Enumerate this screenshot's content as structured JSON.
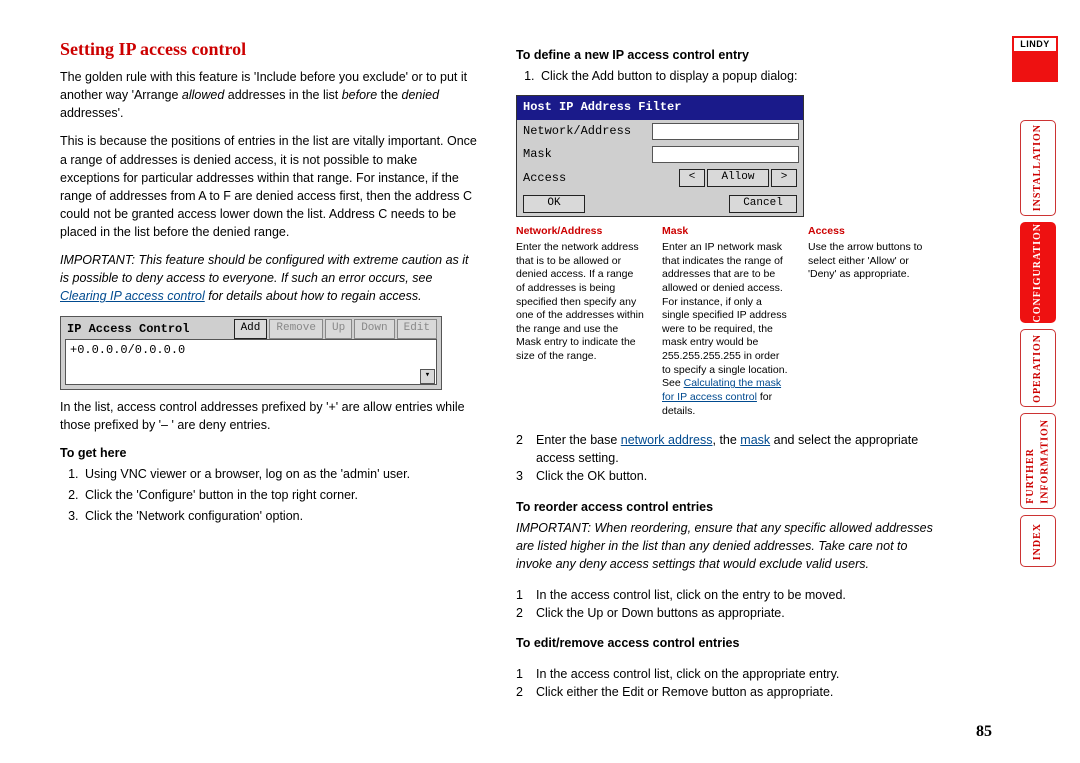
{
  "page_number": "85",
  "logo": "LINDY",
  "nav": {
    "installation": "INSTALLATION",
    "configuration": "CONFIGURATION",
    "operation": "OPERATION",
    "further_info": "FURTHER\nINFORMATION",
    "index": "INDEX"
  },
  "left": {
    "h1": "Setting IP access control",
    "p1a": "The golden rule with this feature is 'Include before you exclude' or to put it another way 'Arrange ",
    "p1b": "allowed",
    "p1c": " addresses in the list ",
    "p1d": "before",
    "p1e": " the ",
    "p1f": "denied",
    "p1g": " addresses'.",
    "p2": "This is because the positions of entries in the list are vitally important. Once a range of addresses is denied access, it is not possible to make exceptions for particular addresses within that range. For instance, if the range of addresses from A to F are denied access first, then the address C could not be granted access lower down the list. Address C needs to be placed in the list before the denied range.",
    "p3a": "IMPORTANT: This feature should be configured with extreme caution as it is possible to deny access to everyone. If such an error occurs, see ",
    "p3link": "Clearing IP access control",
    "p3b": " for details about how to regain access.",
    "panel": {
      "title": "IP Access Control",
      "entry": "+0.0.0.0/0.0.0.0",
      "btn_add": "Add",
      "btn_remove": "Remove",
      "btn_up": "Up",
      "btn_down": "Down",
      "btn_edit": "Edit"
    },
    "p4": "In the list, access control addresses prefixed by '+' are allow entries while those prefixed by '– ' are deny entries.",
    "h_get": "To get here",
    "get1": "Using VNC viewer or a browser, log on as the 'admin' user.",
    "get2": "Click the 'Configure' button in the top right corner.",
    "get3": "Click the 'Network configuration' option."
  },
  "right": {
    "h_def": "To define a new IP access control entry",
    "def1": "Click the Add button to display a popup dialog:",
    "dialog": {
      "title": "Host IP Address Filter",
      "lbl_net": "Network/Address",
      "lbl_mask": "Mask",
      "lbl_access": "Access",
      "left_arrow": "<",
      "allow": "Allow",
      "right_arrow": ">",
      "ok": "OK",
      "cancel": "Cancel"
    },
    "defs": {
      "net_h": "Network/Address",
      "net_t": "Enter the network address that is to be allowed or denied access. If a range of addresses is being specified then specify any one of the addresses within the range and use the Mask entry to indicate the size of the range.",
      "mask_h": "Mask",
      "mask_t1": "Enter an IP network mask that indicates the range of addresses that are to be allowed or denied access. For instance, if only a single specified IP address were to be required, the mask entry would be 255.255.255.255 in order to specify a single location. See ",
      "mask_link": "Calculating the mask for IP access control",
      "mask_t2": " for details.",
      "acc_h": "Access",
      "acc_t": "Use the arrow buttons to select either 'Allow' or 'Deny' as appropriate."
    },
    "def2a": "Enter the base ",
    "def2link1": "network address",
    "def2b": ", the ",
    "def2link2": "mask",
    "def2c": " and select the appropriate access setting.",
    "def3": "Click the OK button.",
    "h_reorder": "To reorder access control entries",
    "reorder_note": "IMPORTANT: When reordering, ensure that any specific allowed addresses are listed higher in the list than any denied addresses. Take care not to invoke any deny access settings that would exclude valid users.",
    "reorder1": "In the access control list, click on the entry to be moved.",
    "reorder2": "Click the Up or Down buttons as appropriate.",
    "h_edit": "To edit/remove access control entries",
    "edit1": "In the access control list, click on the appropriate entry.",
    "edit2": "Click either the Edit or Remove button as appropriate."
  }
}
